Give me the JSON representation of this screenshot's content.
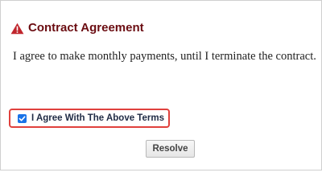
{
  "dialog": {
    "title": "Contract Agreement",
    "title_icon": "warning-triangle-icon",
    "message": "I agree to make monthly payments, until I terminate the contract.",
    "agree_checkbox": {
      "label": "I Agree With The Above Terms",
      "checked": true
    },
    "resolve_button_label": "Resolve"
  },
  "colors": {
    "title": "#6b0d12",
    "warning_icon": "#c0262d",
    "highlight_border": "#e0413d",
    "checkbox_fill": "#1a73e8"
  }
}
